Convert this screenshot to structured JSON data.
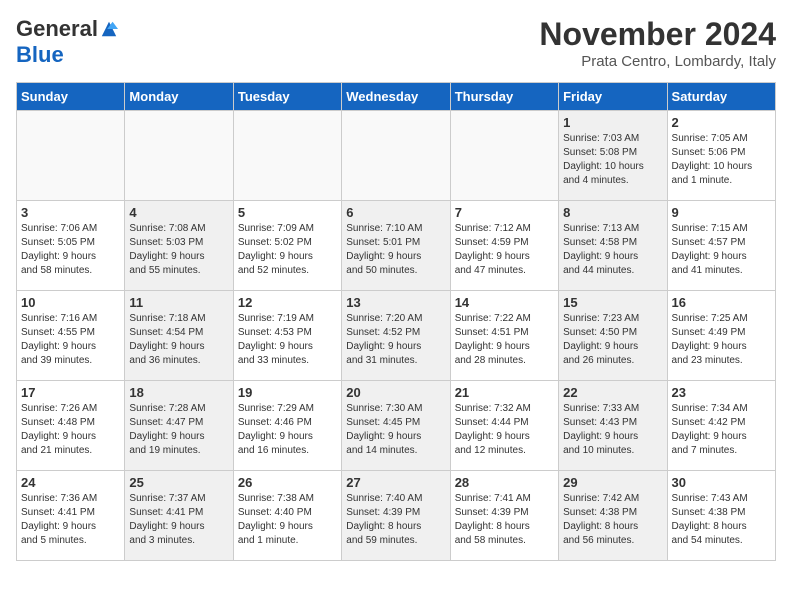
{
  "header": {
    "logo_general": "General",
    "logo_blue": "Blue",
    "month_title": "November 2024",
    "location": "Prata Centro, Lombardy, Italy"
  },
  "weekdays": [
    "Sunday",
    "Monday",
    "Tuesday",
    "Wednesday",
    "Thursday",
    "Friday",
    "Saturday"
  ],
  "weeks": [
    [
      {
        "day": "",
        "info": "",
        "shaded": false,
        "empty": true
      },
      {
        "day": "",
        "info": "",
        "shaded": false,
        "empty": true
      },
      {
        "day": "",
        "info": "",
        "shaded": false,
        "empty": true
      },
      {
        "day": "",
        "info": "",
        "shaded": false,
        "empty": true
      },
      {
        "day": "",
        "info": "",
        "shaded": false,
        "empty": true
      },
      {
        "day": "1",
        "info": "Sunrise: 7:03 AM\nSunset: 5:08 PM\nDaylight: 10 hours\nand 4 minutes.",
        "shaded": true,
        "empty": false
      },
      {
        "day": "2",
        "info": "Sunrise: 7:05 AM\nSunset: 5:06 PM\nDaylight: 10 hours\nand 1 minute.",
        "shaded": false,
        "empty": false
      }
    ],
    [
      {
        "day": "3",
        "info": "Sunrise: 7:06 AM\nSunset: 5:05 PM\nDaylight: 9 hours\nand 58 minutes.",
        "shaded": false,
        "empty": false
      },
      {
        "day": "4",
        "info": "Sunrise: 7:08 AM\nSunset: 5:03 PM\nDaylight: 9 hours\nand 55 minutes.",
        "shaded": true,
        "empty": false
      },
      {
        "day": "5",
        "info": "Sunrise: 7:09 AM\nSunset: 5:02 PM\nDaylight: 9 hours\nand 52 minutes.",
        "shaded": false,
        "empty": false
      },
      {
        "day": "6",
        "info": "Sunrise: 7:10 AM\nSunset: 5:01 PM\nDaylight: 9 hours\nand 50 minutes.",
        "shaded": true,
        "empty": false
      },
      {
        "day": "7",
        "info": "Sunrise: 7:12 AM\nSunset: 4:59 PM\nDaylight: 9 hours\nand 47 minutes.",
        "shaded": false,
        "empty": false
      },
      {
        "day": "8",
        "info": "Sunrise: 7:13 AM\nSunset: 4:58 PM\nDaylight: 9 hours\nand 44 minutes.",
        "shaded": true,
        "empty": false
      },
      {
        "day": "9",
        "info": "Sunrise: 7:15 AM\nSunset: 4:57 PM\nDaylight: 9 hours\nand 41 minutes.",
        "shaded": false,
        "empty": false
      }
    ],
    [
      {
        "day": "10",
        "info": "Sunrise: 7:16 AM\nSunset: 4:55 PM\nDaylight: 9 hours\nand 39 minutes.",
        "shaded": false,
        "empty": false
      },
      {
        "day": "11",
        "info": "Sunrise: 7:18 AM\nSunset: 4:54 PM\nDaylight: 9 hours\nand 36 minutes.",
        "shaded": true,
        "empty": false
      },
      {
        "day": "12",
        "info": "Sunrise: 7:19 AM\nSunset: 4:53 PM\nDaylight: 9 hours\nand 33 minutes.",
        "shaded": false,
        "empty": false
      },
      {
        "day": "13",
        "info": "Sunrise: 7:20 AM\nSunset: 4:52 PM\nDaylight: 9 hours\nand 31 minutes.",
        "shaded": true,
        "empty": false
      },
      {
        "day": "14",
        "info": "Sunrise: 7:22 AM\nSunset: 4:51 PM\nDaylight: 9 hours\nand 28 minutes.",
        "shaded": false,
        "empty": false
      },
      {
        "day": "15",
        "info": "Sunrise: 7:23 AM\nSunset: 4:50 PM\nDaylight: 9 hours\nand 26 minutes.",
        "shaded": true,
        "empty": false
      },
      {
        "day": "16",
        "info": "Sunrise: 7:25 AM\nSunset: 4:49 PM\nDaylight: 9 hours\nand 23 minutes.",
        "shaded": false,
        "empty": false
      }
    ],
    [
      {
        "day": "17",
        "info": "Sunrise: 7:26 AM\nSunset: 4:48 PM\nDaylight: 9 hours\nand 21 minutes.",
        "shaded": false,
        "empty": false
      },
      {
        "day": "18",
        "info": "Sunrise: 7:28 AM\nSunset: 4:47 PM\nDaylight: 9 hours\nand 19 minutes.",
        "shaded": true,
        "empty": false
      },
      {
        "day": "19",
        "info": "Sunrise: 7:29 AM\nSunset: 4:46 PM\nDaylight: 9 hours\nand 16 minutes.",
        "shaded": false,
        "empty": false
      },
      {
        "day": "20",
        "info": "Sunrise: 7:30 AM\nSunset: 4:45 PM\nDaylight: 9 hours\nand 14 minutes.",
        "shaded": true,
        "empty": false
      },
      {
        "day": "21",
        "info": "Sunrise: 7:32 AM\nSunset: 4:44 PM\nDaylight: 9 hours\nand 12 minutes.",
        "shaded": false,
        "empty": false
      },
      {
        "day": "22",
        "info": "Sunrise: 7:33 AM\nSunset: 4:43 PM\nDaylight: 9 hours\nand 10 minutes.",
        "shaded": true,
        "empty": false
      },
      {
        "day": "23",
        "info": "Sunrise: 7:34 AM\nSunset: 4:42 PM\nDaylight: 9 hours\nand 7 minutes.",
        "shaded": false,
        "empty": false
      }
    ],
    [
      {
        "day": "24",
        "info": "Sunrise: 7:36 AM\nSunset: 4:41 PM\nDaylight: 9 hours\nand 5 minutes.",
        "shaded": false,
        "empty": false
      },
      {
        "day": "25",
        "info": "Sunrise: 7:37 AM\nSunset: 4:41 PM\nDaylight: 9 hours\nand 3 minutes.",
        "shaded": true,
        "empty": false
      },
      {
        "day": "26",
        "info": "Sunrise: 7:38 AM\nSunset: 4:40 PM\nDaylight: 9 hours\nand 1 minute.",
        "shaded": false,
        "empty": false
      },
      {
        "day": "27",
        "info": "Sunrise: 7:40 AM\nSunset: 4:39 PM\nDaylight: 8 hours\nand 59 minutes.",
        "shaded": true,
        "empty": false
      },
      {
        "day": "28",
        "info": "Sunrise: 7:41 AM\nSunset: 4:39 PM\nDaylight: 8 hours\nand 58 minutes.",
        "shaded": false,
        "empty": false
      },
      {
        "day": "29",
        "info": "Sunrise: 7:42 AM\nSunset: 4:38 PM\nDaylight: 8 hours\nand 56 minutes.",
        "shaded": true,
        "empty": false
      },
      {
        "day": "30",
        "info": "Sunrise: 7:43 AM\nSunset: 4:38 PM\nDaylight: 8 hours\nand 54 minutes.",
        "shaded": false,
        "empty": false
      }
    ]
  ]
}
